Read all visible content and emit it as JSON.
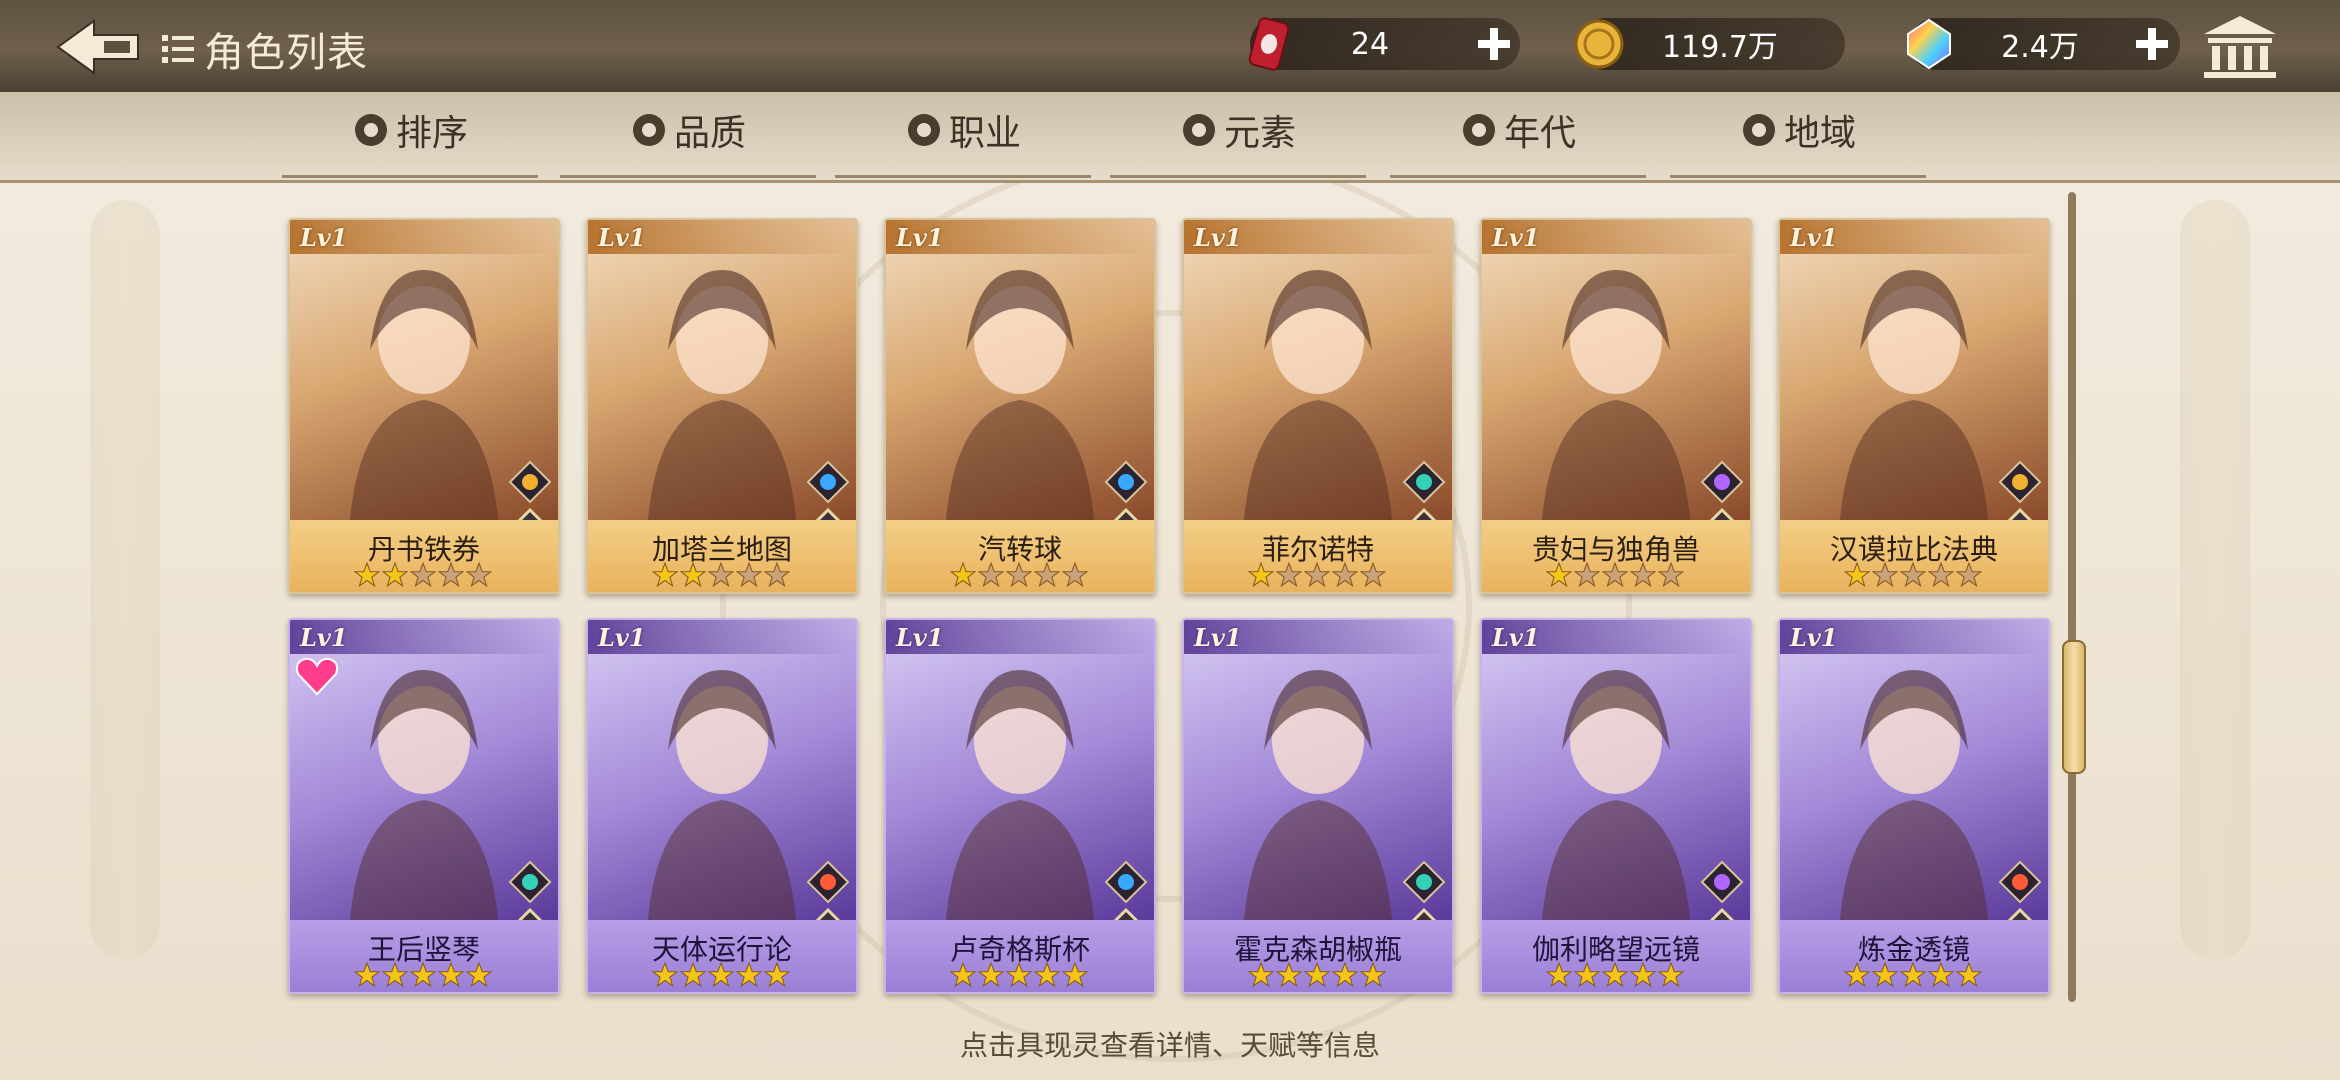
{
  "header": {
    "title": "角色列表",
    "resources": [
      {
        "icon": "soda-can-icon",
        "value": "24"
      },
      {
        "icon": "gold-coin-icon",
        "value": "119.7万"
      },
      {
        "icon": "rainbow-gem-icon",
        "value": "2.4万"
      }
    ]
  },
  "filters": [
    {
      "label": "排序",
      "icon": "sort-icon"
    },
    {
      "label": "品质",
      "icon": "gem-quality-icon"
    },
    {
      "label": "职业",
      "icon": "class-icon"
    },
    {
      "label": "元素",
      "icon": "element-swirl-icon"
    },
    {
      "label": "年代",
      "icon": "era-icon"
    },
    {
      "label": "地域",
      "icon": "location-pin-icon"
    }
  ],
  "cards": [
    {
      "level": "Lv1",
      "name": "丹书铁券",
      "stars": 2,
      "rarity": "gold",
      "element": "earth",
      "class": "shield"
    },
    {
      "level": "Lv1",
      "name": "加塔兰地图",
      "stars": 2,
      "rarity": "gold",
      "element": "water",
      "class": "shield"
    },
    {
      "level": "Lv1",
      "name": "汽转球",
      "stars": 1,
      "rarity": "gold",
      "element": "water",
      "class": "trident"
    },
    {
      "level": "Lv1",
      "name": "菲尔诺特",
      "stars": 1,
      "rarity": "gold",
      "element": "wind",
      "class": "trident"
    },
    {
      "level": "Lv1",
      "name": "贵妇与独角兽",
      "stars": 1,
      "rarity": "gold",
      "element": "thunder",
      "class": "tome"
    },
    {
      "level": "Lv1",
      "name": "汉谟拉比法典",
      "stars": 1,
      "rarity": "gold",
      "element": "earth",
      "class": "trident"
    },
    {
      "level": "Lv1",
      "name": "王后竖琴",
      "stars": 5,
      "rarity": "purple",
      "element": "wind",
      "class": "tome",
      "favorite": true
    },
    {
      "level": "Lv1",
      "name": "天体运行论",
      "stars": 5,
      "rarity": "purple",
      "element": "fire",
      "class": "tome"
    },
    {
      "level": "Lv1",
      "name": "卢奇格斯杯",
      "stars": 5,
      "rarity": "purple",
      "element": "water",
      "class": "tome"
    },
    {
      "level": "Lv1",
      "name": "霍克森胡椒瓶",
      "stars": 5,
      "rarity": "purple",
      "element": "wind",
      "class": "tome"
    },
    {
      "level": "Lv1",
      "name": "伽利略望远镜",
      "stars": 5,
      "rarity": "purple",
      "element": "thunder",
      "class": "trident"
    },
    {
      "level": "Lv1",
      "name": "炼金透镜",
      "stars": 5,
      "rarity": "purple",
      "element": "fire",
      "class": "trident"
    }
  ],
  "hint": "点击具现灵查看详情、天赋等信息",
  "colors": {
    "gold_card": "#d7a466",
    "purple_card": "#8c6cc7",
    "star": "#f5c518",
    "star_empty": "#c9a27a"
  }
}
